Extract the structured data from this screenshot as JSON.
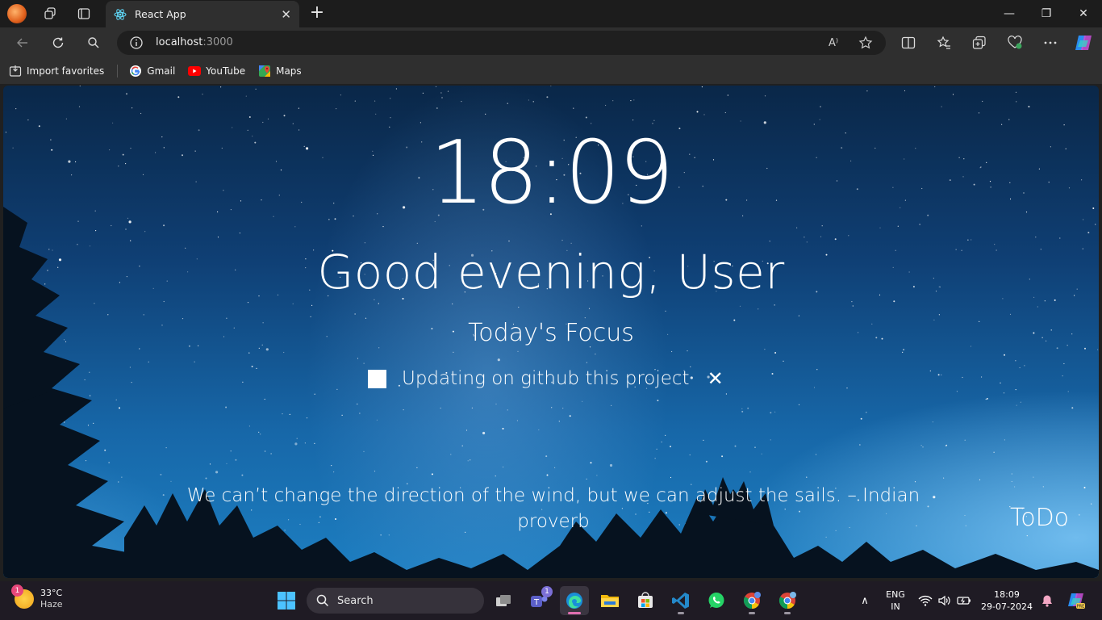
{
  "browser": {
    "tab": {
      "title": "React App",
      "close": "✕"
    },
    "new_tab": "+",
    "window_controls": {
      "minimize": "—",
      "maximize": "❐",
      "close": "✕"
    },
    "address": {
      "host": "localhost",
      "port": ":3000"
    },
    "read_aloud": "A⁾"
  },
  "favorites": [
    {
      "label": "Import favorites",
      "icon": "import-icon"
    },
    {
      "label": "Gmail",
      "icon": "google-icon"
    },
    {
      "label": "YouTube",
      "icon": "youtube-icon"
    },
    {
      "label": "Maps",
      "icon": "maps-icon"
    }
  ],
  "app": {
    "time": "18:09",
    "greeting": "Good evening, User",
    "focus_label": "Today's Focus",
    "focus_task": "Updating on github this project",
    "focus_remove": "✕",
    "quote": "We can’t change the direction of the wind, but we can adjust the sails. – Indian proverb",
    "todo_link": "ToDo"
  },
  "taskbar": {
    "weather": {
      "temp": "33°C",
      "condition": "Haze",
      "badge": "1"
    },
    "search_placeholder": "Search",
    "teams_badge": "1",
    "lang": {
      "line1": "ENG",
      "line2": "IN"
    },
    "clock": {
      "time": "18:09",
      "date": "29-07-2024"
    },
    "overflow": "∧"
  }
}
